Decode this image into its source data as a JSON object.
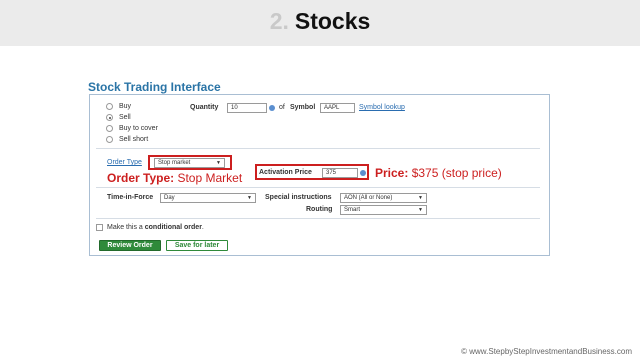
{
  "slide": {
    "number": "2.",
    "title": "Stocks"
  },
  "panel_title": "Stock Trading Interface",
  "actions": [
    "Buy",
    "Sell",
    "Buy to cover",
    "Sell short"
  ],
  "selected_action": "Sell",
  "quantity": {
    "label": "Quantity",
    "value": "10"
  },
  "symbol": {
    "of_text": "of",
    "label": "Symbol",
    "value": "AAPL",
    "lookup_link": "Symbol lookup"
  },
  "order_type": {
    "label": "Order Type",
    "value": "Stop market"
  },
  "activation_price": {
    "label": "Activation Price",
    "value": "375"
  },
  "annotations": {
    "order_type_label": "Order Type:",
    "order_type_value": "Stop Market",
    "price_label": "Price:",
    "price_value": "$375 (stop price)"
  },
  "time_in_force": {
    "label": "Time-in-Force",
    "value": "Day"
  },
  "special_instructions": {
    "label": "Special instructions",
    "value": "AON (All or None)"
  },
  "routing": {
    "label": "Routing",
    "value": "Smart"
  },
  "conditional": {
    "prefix": "Make this a ",
    "bold": "conditional order",
    "suffix": "."
  },
  "buttons": {
    "review": "Review Order",
    "save": "Save for later"
  },
  "copyright": "© www.StepbyStepInvestmentandBusiness.com",
  "colors": {
    "accent_blue": "#2a74a6",
    "highlight_red": "#cc1f1f",
    "button_green": "#2f8a3a"
  }
}
